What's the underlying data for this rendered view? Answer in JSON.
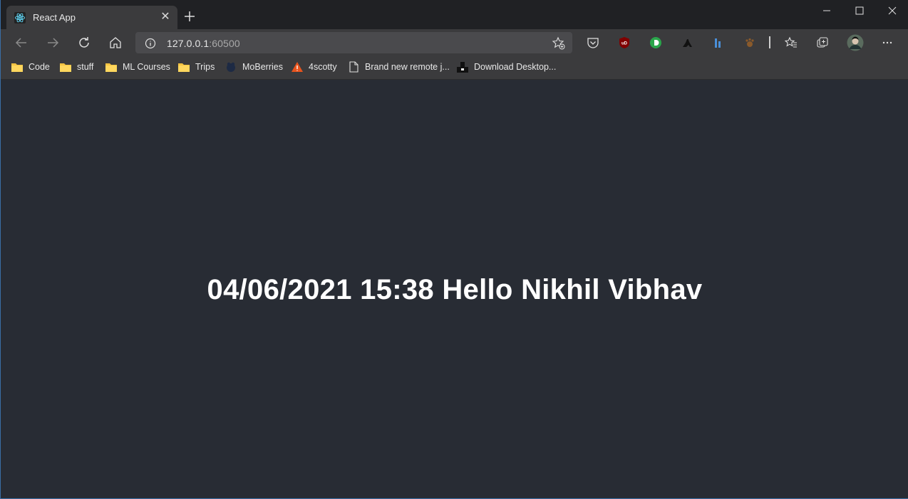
{
  "tab": {
    "title": "React App",
    "favicon": "react-logo-icon",
    "close_glyph": "✕"
  },
  "address": {
    "host": "127.0.0.1",
    "port": ":60500"
  },
  "bookmarks": [
    {
      "label": "Code",
      "icon": "folder-icon"
    },
    {
      "label": "stuff",
      "icon": "folder-icon"
    },
    {
      "label": "ML Courses",
      "icon": "folder-icon"
    },
    {
      "label": "Trips",
      "icon": "folder-icon"
    },
    {
      "label": "MoBerries",
      "icon": "moberries-icon"
    },
    {
      "label": "4scotty",
      "icon": "4scotty-icon"
    },
    {
      "label": "Brand new remote j...",
      "icon": "page-icon"
    },
    {
      "label": "Download Desktop...",
      "icon": "download-icon"
    }
  ],
  "extensions": [
    "pocket-icon",
    "ublock-icon",
    "green-d-icon",
    "bird-icon",
    "stats-icon",
    "paw-icon"
  ],
  "main": {
    "greeting": "04/06/2021 15:38 Hello Nikhil Vibhav"
  },
  "colors": {
    "page_bg": "#282c34",
    "tab_bg": "#3b3b3d",
    "titlebar_bg": "#202124",
    "react_blue": "#61dafb"
  }
}
